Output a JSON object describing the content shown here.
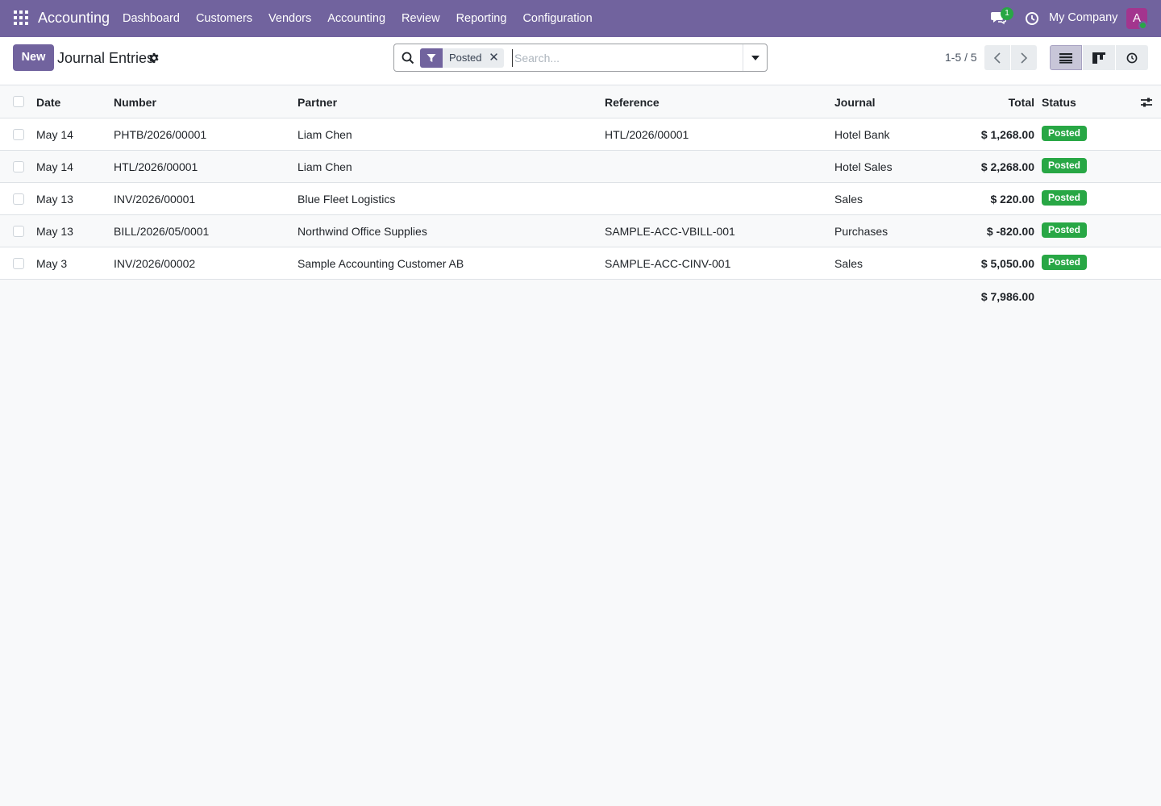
{
  "navbar": {
    "app_name": "Accounting",
    "menu": [
      "Dashboard",
      "Customers",
      "Vendors",
      "Accounting",
      "Review",
      "Reporting",
      "Configuration"
    ],
    "chat_badge": "1",
    "company": "My Company",
    "avatar_initial": "A",
    "bg_color": "#71639e"
  },
  "control": {
    "new_label": "New",
    "title": "Journal Entries",
    "search": {
      "facet_label": "Posted",
      "placeholder": "Search..."
    },
    "pager": "1-5 / 5"
  },
  "table": {
    "headers": {
      "date": "Date",
      "number": "Number",
      "partner": "Partner",
      "reference": "Reference",
      "journal": "Journal",
      "total": "Total",
      "status": "Status"
    },
    "rows": [
      {
        "date": "May 14",
        "number": "PHTB/2026/00001",
        "partner": "Liam Chen",
        "reference": "HTL/2026/00001",
        "journal": "Hotel Bank",
        "total": "$ 1,268.00",
        "status": "Posted"
      },
      {
        "date": "May 14",
        "number": "HTL/2026/00001",
        "partner": "Liam Chen",
        "reference": "",
        "journal": "Hotel Sales",
        "total": "$ 2,268.00",
        "status": "Posted"
      },
      {
        "date": "May 13",
        "number": "INV/2026/00001",
        "partner": "Blue Fleet Logistics",
        "reference": "",
        "journal": "Sales",
        "total": "$ 220.00",
        "status": "Posted"
      },
      {
        "date": "May 13",
        "number": "BILL/2026/05/0001",
        "partner": "Northwind Office Supplies",
        "reference": "SAMPLE-ACC-VBILL-001",
        "journal": "Purchases",
        "total": "$ -820.00",
        "status": "Posted"
      },
      {
        "date": "May 3",
        "number": "INV/2026/00002",
        "partner": "Sample Accounting Customer AB",
        "reference": "SAMPLE-ACC-CINV-001",
        "journal": "Sales",
        "total": "$ 5,050.00",
        "status": "Posted"
      }
    ],
    "grand_total": "$ 7,986.00",
    "status_color": "#28a745"
  }
}
